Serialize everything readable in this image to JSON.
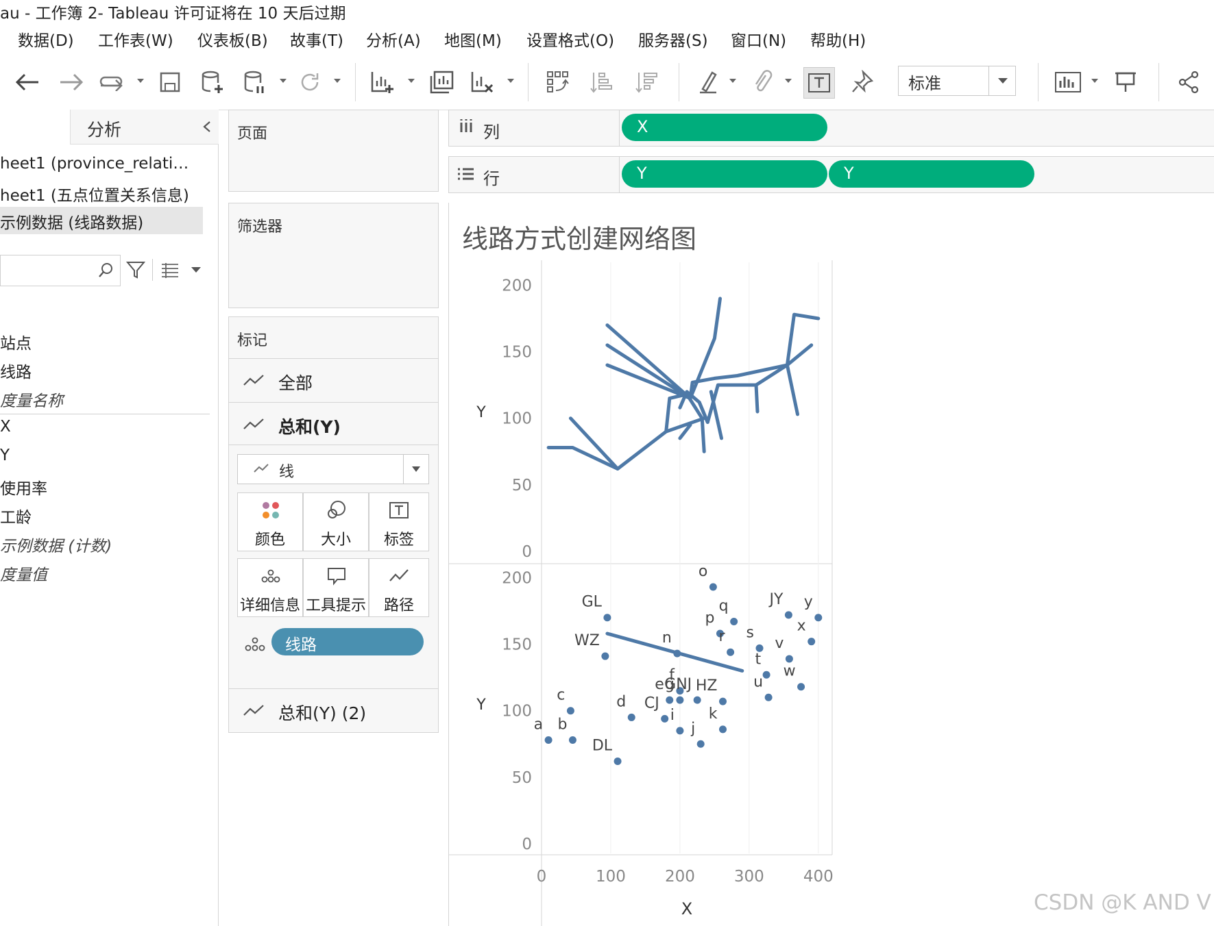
{
  "window": {
    "title": "au - 工作簿 2- Tableau 许可证将在 10 天后过期"
  },
  "menu": [
    "数据(D)",
    "工作表(W)",
    "仪表板(B)",
    "故事(T)",
    "分析(A)",
    "地图(M)",
    "设置格式(O)",
    "服务器(S)",
    "窗口(N)",
    "帮助(H)"
  ],
  "toolbar": {
    "fit_select": "标准"
  },
  "left_pane": {
    "tab": "分析",
    "data_sources": [
      "heet1 (province_relati…",
      "heet1 (五点位置关系信息)",
      "示例数据 (线路数据)"
    ],
    "dimensions": [
      "站点",
      "线路",
      "度量名称"
    ],
    "measures": [
      "X",
      "Y",
      "使用率",
      "工龄",
      "示例数据 (计数)",
      "度量值"
    ]
  },
  "pages": {
    "title": "页面"
  },
  "filters": {
    "title": "筛选器"
  },
  "marks": {
    "title": "标记",
    "cards": [
      "全部",
      "总和(Y)",
      "总和(Y) (2)"
    ],
    "mark_type": "线",
    "buttons": [
      "颜色",
      "大小",
      "标签",
      "详细信息",
      "工具提示",
      "路径"
    ],
    "detail_pill": "线路"
  },
  "shelves": {
    "columns": {
      "label": "列",
      "pills": [
        "X"
      ]
    },
    "rows": {
      "label": "行",
      "pills": [
        "Y",
        "Y"
      ]
    }
  },
  "watermark": "CSDN @K AND V",
  "colors": {
    "accent": "#00ad7c",
    "line": "#4e79a7",
    "detail_pill": "#4a90b0"
  },
  "chart_data": [
    {
      "type": "line",
      "title": "线路方式创建网络图",
      "xlabel": "X",
      "ylabel": "Y",
      "xlim": [
        0,
        420
      ],
      "ylim": [
        0,
        210
      ],
      "xticks": [
        0,
        100,
        200,
        300,
        400
      ],
      "yticks": [
        0,
        50,
        100,
        150,
        200
      ],
      "series": [
        {
          "points": [
            [
              10,
              78
            ],
            [
              45,
              78
            ],
            [
              110,
              62
            ],
            [
              180,
              90
            ],
            [
              235,
              100
            ]
          ]
        },
        {
          "points": [
            [
              42,
              100
            ],
            [
              110,
              62
            ]
          ]
        },
        {
          "points": [
            [
              180,
              90
            ],
            [
              185,
              115
            ],
            [
              210,
              118
            ],
            [
              232,
              100
            ],
            [
              235,
              75
            ]
          ]
        },
        {
          "points": [
            [
              95,
              170
            ],
            [
              215,
              115
            ],
            [
              250,
              160
            ],
            [
              258,
              190
            ]
          ]
        },
        {
          "points": [
            [
              95,
              155
            ],
            [
              215,
              115
            ]
          ]
        },
        {
          "points": [
            [
              95,
              140
            ],
            [
              215,
              115
            ],
            [
              218,
              127
            ],
            [
              250,
              130
            ],
            [
              283,
              132
            ],
            [
              355,
              140
            ],
            [
              365,
              178
            ],
            [
              400,
              175
            ]
          ]
        },
        {
          "points": [
            [
              228,
              112
            ],
            [
              240,
              97
            ],
            [
              255,
              125
            ],
            [
              310,
              125
            ],
            [
              355,
              140
            ],
            [
              390,
              155
            ]
          ]
        },
        {
          "points": [
            [
              200,
              108
            ],
            [
              210,
              120
            ],
            [
              228,
              112
            ],
            [
              240,
              97
            ]
          ]
        },
        {
          "points": [
            [
              245,
              120
            ],
            [
              260,
              85
            ]
          ]
        },
        {
          "points": [
            [
              310,
              125
            ],
            [
              312,
              105
            ]
          ]
        },
        {
          "points": [
            [
              355,
              140
            ],
            [
              370,
              103
            ]
          ]
        },
        {
          "points": [
            [
              200,
              85
            ],
            [
              215,
              95
            ]
          ]
        }
      ]
    },
    {
      "type": "scatter",
      "xlabel": "X",
      "ylabel": "Y",
      "xlim": [
        0,
        420
      ],
      "ylim": [
        0,
        210
      ],
      "xticks": [
        0,
        100,
        200,
        300,
        400
      ],
      "yticks": [
        0,
        50,
        100,
        150,
        200
      ],
      "points": [
        {
          "label": "a",
          "x": 10,
          "y": 78
        },
        {
          "label": "b",
          "x": 45,
          "y": 78
        },
        {
          "label": "c",
          "x": 42,
          "y": 100
        },
        {
          "label": "d",
          "x": 130,
          "y": 95
        },
        {
          "label": "DL",
          "x": 110,
          "y": 62
        },
        {
          "label": "CJ",
          "x": 178,
          "y": 94
        },
        {
          "label": "e",
          "x": 185,
          "y": 108
        },
        {
          "label": "f",
          "x": 200,
          "y": 115
        },
        {
          "label": "g",
          "x": 200,
          "y": 108
        },
        {
          "label": "i",
          "x": 200,
          "y": 85
        },
        {
          "label": "j",
          "x": 230,
          "y": 75
        },
        {
          "label": "k",
          "x": 262,
          "y": 86
        },
        {
          "label": "GL",
          "x": 95,
          "y": 170
        },
        {
          "label": "WZ",
          "x": 92,
          "y": 141
        },
        {
          "label": "n",
          "x": 196,
          "y": 143
        },
        {
          "label": "o",
          "x": 248,
          "y": 193
        },
        {
          "label": "q",
          "x": 278,
          "y": 167
        },
        {
          "label": "p",
          "x": 258,
          "y": 158
        },
        {
          "label": "r",
          "x": 273,
          "y": 144
        },
        {
          "label": "s",
          "x": 315,
          "y": 147
        },
        {
          "label": "t",
          "x": 325,
          "y": 127
        },
        {
          "label": "u",
          "x": 328,
          "y": 110
        },
        {
          "label": "v",
          "x": 358,
          "y": 139
        },
        {
          "label": "w",
          "x": 375,
          "y": 118
        },
        {
          "label": "x",
          "x": 390,
          "y": 152
        },
        {
          "label": "y",
          "x": 400,
          "y": 170
        },
        {
          "label": "JY",
          "x": 357,
          "y": 172
        },
        {
          "label": "HZ",
          "x": 262,
          "y": 107
        },
        {
          "label": "GNJ",
          "x": 225,
          "y": 108
        }
      ],
      "line": {
        "points": [
          [
            95,
            158
          ],
          [
            290,
            130
          ]
        ]
      }
    }
  ]
}
